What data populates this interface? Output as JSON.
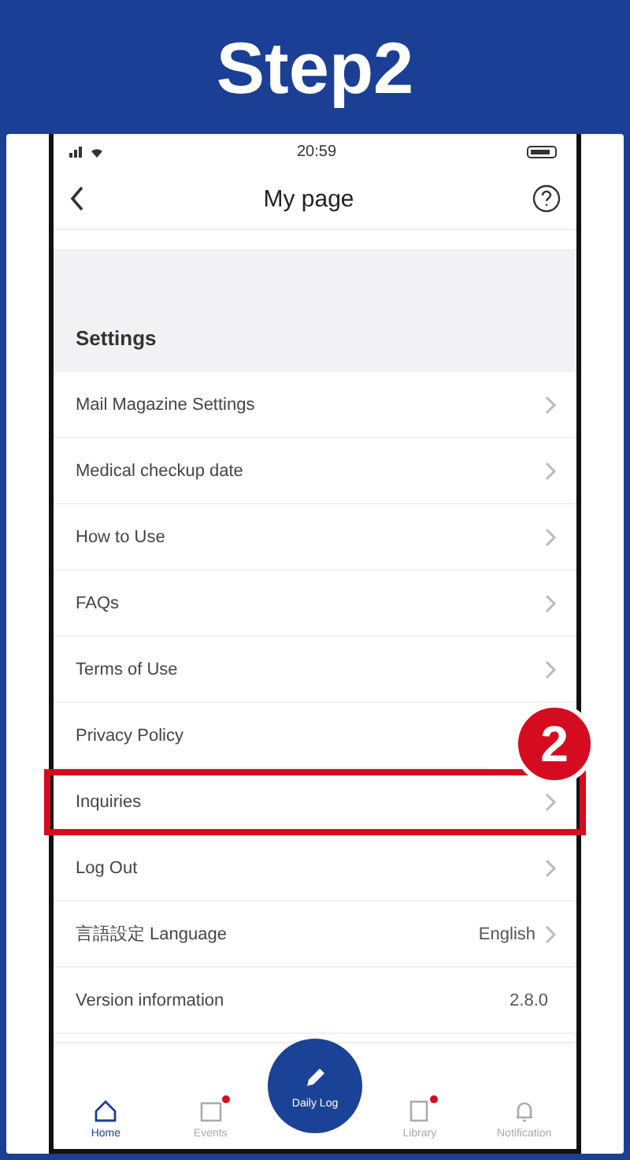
{
  "step_title": "Step2",
  "step_badge": "2",
  "status_bar": {
    "time": "20:59"
  },
  "nav": {
    "title": "My page"
  },
  "section": {
    "title": "Settings"
  },
  "settings_items": [
    {
      "label": "Mail Magazine Settings",
      "highlighted": false
    },
    {
      "label": "Medical checkup date",
      "highlighted": false
    },
    {
      "label": "How to Use",
      "highlighted": false
    },
    {
      "label": "FAQs",
      "highlighted": false
    },
    {
      "label": "Terms of Use",
      "highlighted": false
    },
    {
      "label": "Privacy Policy",
      "highlighted": false,
      "chevron": false
    },
    {
      "label": "Inquiries",
      "highlighted": true
    },
    {
      "label": "Log Out",
      "highlighted": false
    },
    {
      "label": "言語設定 Language",
      "value": "English",
      "highlighted": false
    },
    {
      "label": "Version information",
      "value": "2.8.0",
      "highlighted": false,
      "chevron": false
    }
  ],
  "tab_bar": [
    {
      "label": "Home",
      "kind": "home",
      "selected": true,
      "dot": false
    },
    {
      "label": "Events",
      "kind": "calendar",
      "selected": false,
      "dot": true
    },
    {
      "label": "Daily Log",
      "kind": "pen",
      "selected": false
    },
    {
      "label": "Library",
      "kind": "book",
      "selected": false,
      "dot": true
    },
    {
      "label": "Notification",
      "kind": "bell",
      "selected": false,
      "dot": false
    }
  ]
}
